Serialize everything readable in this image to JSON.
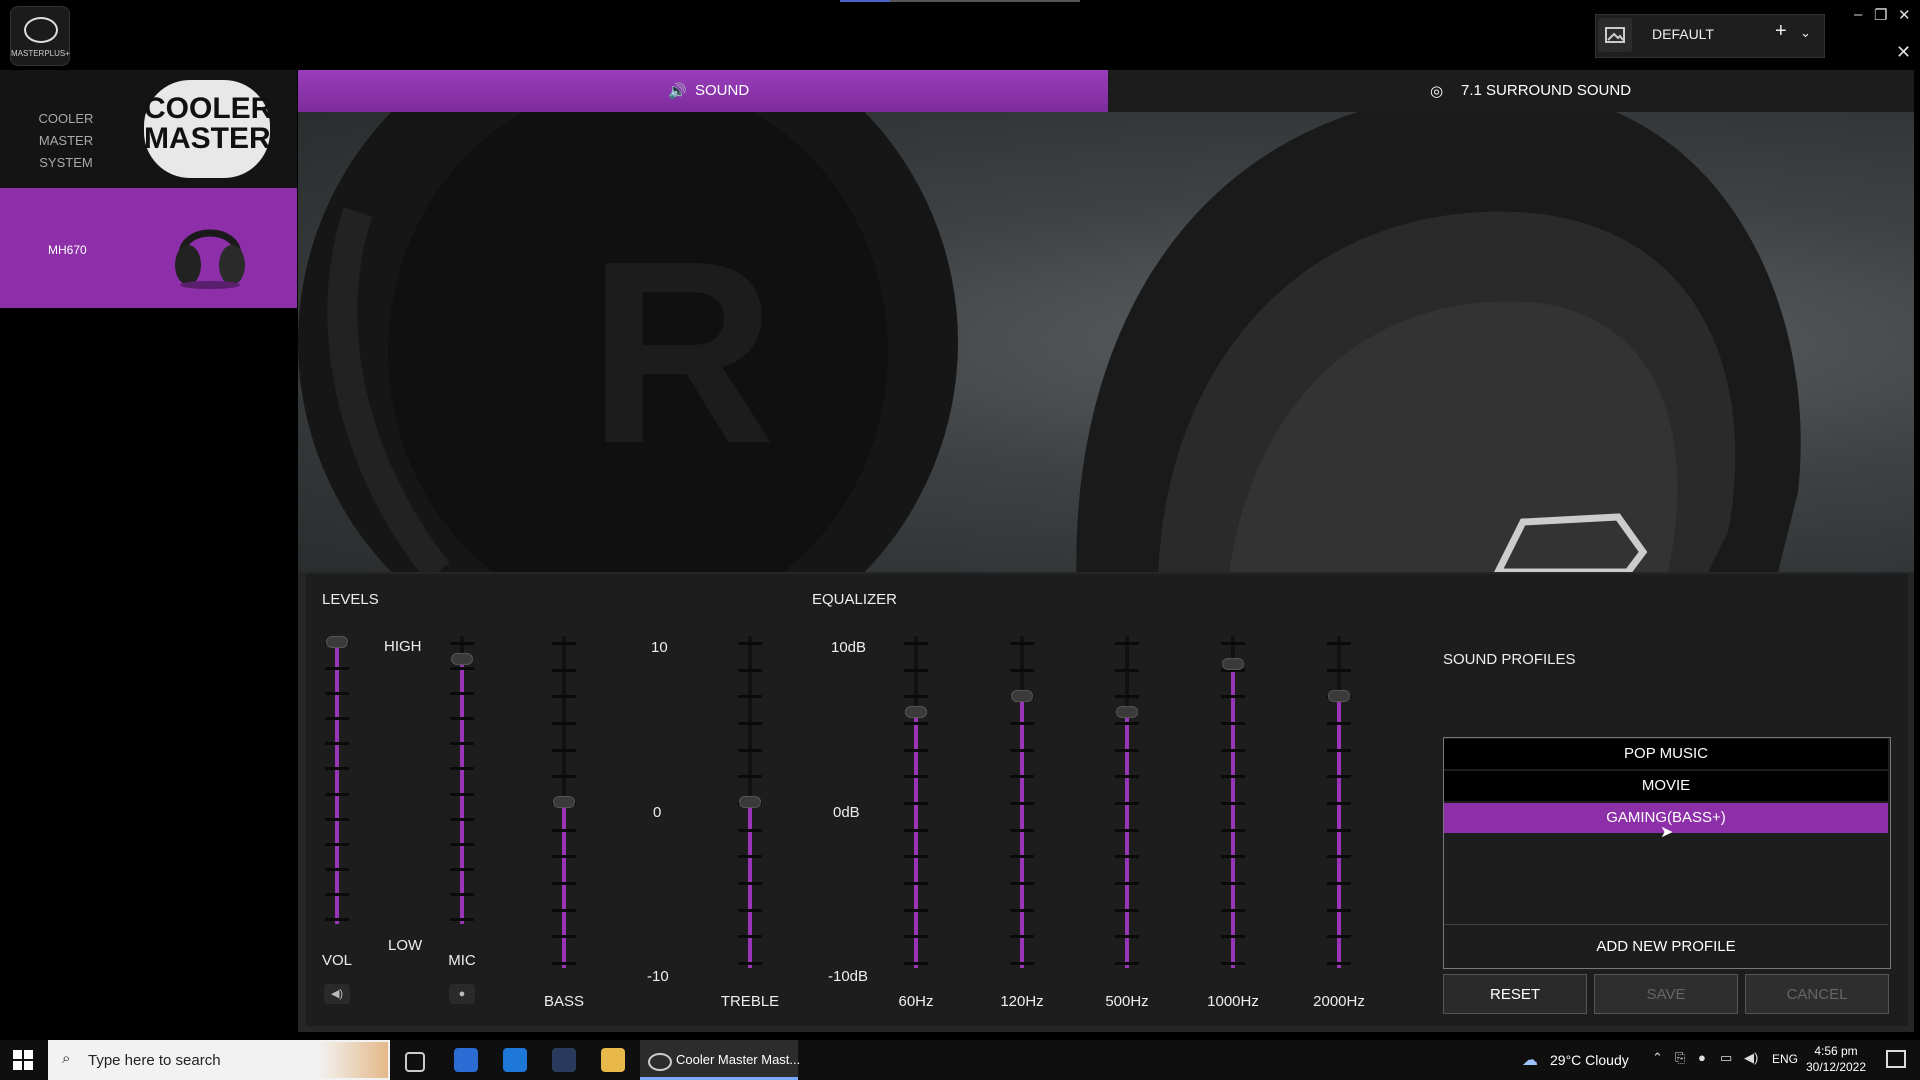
{
  "app": {
    "logo_text": "MASTERPLUS+"
  },
  "header": {
    "profile_name": "DEFAULT",
    "add_icon": "plus-icon",
    "dropdown_icon": "chevron-down-icon"
  },
  "window": {
    "minimize": "–",
    "restore": "❐",
    "close": "✕",
    "close_app": "✕"
  },
  "sidebar": {
    "system_label": "COOLER MASTER SYSTEM",
    "brand_logo": "COOLER MASTER",
    "device_label": "MH670"
  },
  "tabs": [
    {
      "label": "SOUND",
      "icon": "speaker-icon",
      "active": true
    },
    {
      "label": "7.1 SURROUND SOUND",
      "icon": "surround-icon",
      "active": false
    }
  ],
  "levels": {
    "heading": "LEVELS",
    "high": "HIGH",
    "low": "LOW",
    "vol_label": "VOL",
    "mic_label": "MIC",
    "vol_level": 1.0,
    "mic_level": 0.94
  },
  "bass_treble": {
    "bass_label": "BASS",
    "treble_label": "TREBLE",
    "scale_top": "10",
    "scale_mid": "0",
    "scale_bottom": "-10",
    "bass_value": 0,
    "treble_value": 0
  },
  "equalizer": {
    "heading": "EQUALIZER",
    "scale_top": "10dB",
    "scale_mid": "0dB",
    "scale_bottom": "-10dB",
    "bands": [
      {
        "label": "60Hz",
        "level": 0.78
      },
      {
        "label": "120Hz",
        "level": 0.83
      },
      {
        "label": "500Hz",
        "level": 0.78
      },
      {
        "label": "1000Hz",
        "level": 0.93
      },
      {
        "label": "2000Hz",
        "level": 0.83
      }
    ]
  },
  "profiles": {
    "heading": "SOUND PROFILES",
    "items": [
      "POP MUSIC",
      "MOVIE",
      "GAMING(BASS+)"
    ],
    "selected": "GAMING(BASS+)",
    "add_label": "ADD NEW PROFILE",
    "reset_label": "RESET",
    "save_label": "SAVE",
    "cancel_label": "CANCEL"
  },
  "taskbar": {
    "search_placeholder": "Type here to search",
    "app_label": "Cooler Master Mast...",
    "weather": "29°C  Cloudy",
    "lang": "ENG",
    "time": "4:56 pm",
    "date": "30/12/2022"
  },
  "colors": {
    "accent": "#8d2fa8",
    "track": "#111111",
    "fill": "#9b35b8"
  }
}
